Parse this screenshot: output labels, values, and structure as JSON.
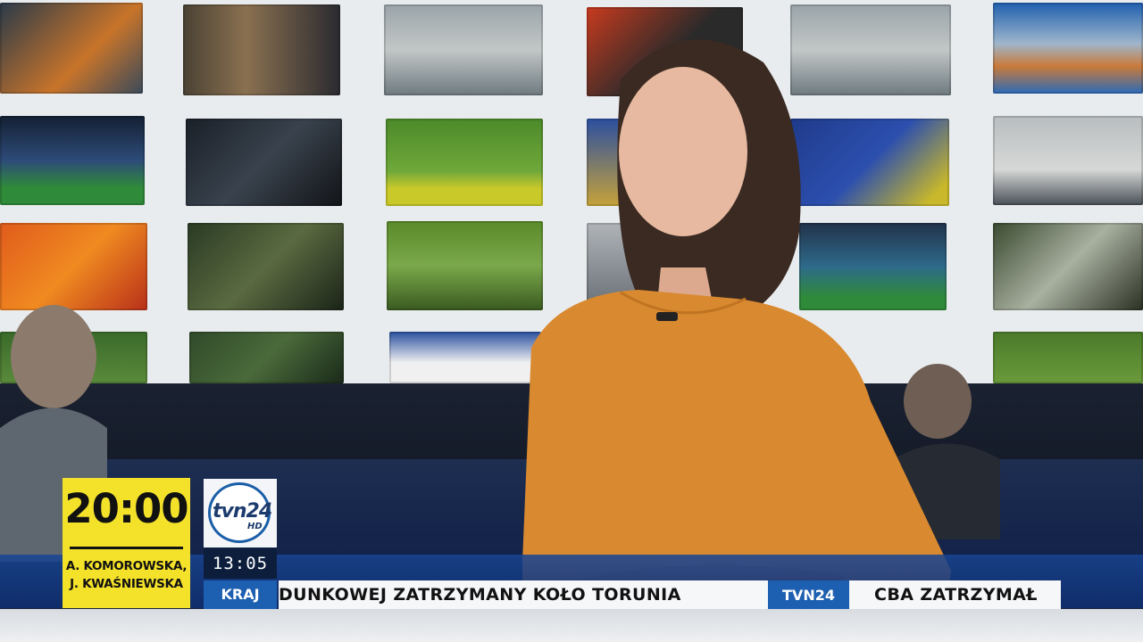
{
  "broadcast": {
    "next_program": {
      "time": "20:00",
      "hosts_line1": "A. KOMOROWSKA,",
      "hosts_line2": "J. KWAŚNIEWSKA"
    },
    "channel_logo": {
      "name": "tvn24",
      "suffix": "HD"
    },
    "clock": "13:05",
    "section": "KRAJ",
    "ticker": {
      "headline_1": "DUNKOWEJ ZATRZYMANY KOŁO TORUNIA",
      "separator": "TVN24",
      "headline_2": "CBA ZATRZYMAŁ"
    }
  },
  "colors": {
    "accent_yellow": "#f4e22a",
    "brand_blue": "#1d5fb0",
    "navy": "#0d1e3d",
    "dress_orange": "#d9892f"
  }
}
